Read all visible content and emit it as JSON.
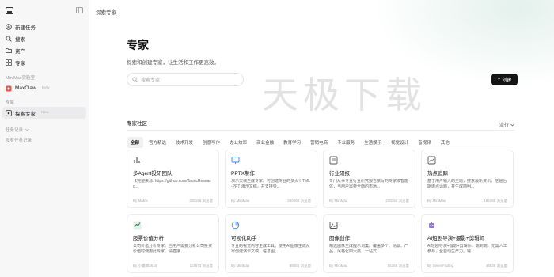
{
  "sidebar": {
    "items": [
      {
        "label": "新建任务",
        "icon": "plus-circle-icon"
      },
      {
        "label": "搜索",
        "icon": "search-icon"
      },
      {
        "label": "资产",
        "icon": "folder-icon"
      },
      {
        "label": "专家",
        "icon": "grid-icon"
      }
    ],
    "lab_section": "MiniMax实验室",
    "lab_item": {
      "label": "MaxClaw",
      "badge": "New"
    },
    "experts_section": "专家",
    "experts_item": {
      "label": "探索专家",
      "badge": "New"
    },
    "history_section": "任务记录",
    "history_empty": "没有任务记录"
  },
  "header": {
    "breadcrumb": "探索专家"
  },
  "hero": {
    "title": "专家",
    "subtitle": "探索和创建专家，让生活和工作更高效。",
    "search_placeholder": "搜索专家",
    "create_label": "创建",
    "watermark": "天极下载"
  },
  "community": {
    "title": "专家社区",
    "sort_label": "流行",
    "categories": [
      "全部",
      "官方精选",
      "技术开发",
      "创意写作",
      "办公效率",
      "商业金融",
      "教育学习",
      "营销电商",
      "专业服务",
      "生活娱乐",
      "视觉设计",
      "音视频",
      "其他"
    ],
    "cards": [
      {
        "title": "多Agent投研团队",
        "desc": "【完整来源: https://github.com/TauricResearc...",
        "author": "By Matrix",
        "views": "325196 浏览量",
        "icon": "chart-icon",
        "icon_color": "#555555"
      },
      {
        "title": "PPTX制作",
        "desc": "演示文稿生成专家。可创建专业的多页 HTML-PPT 演示文稿，并支持导...",
        "author": "By MiniMax",
        "views": "260098 浏览量",
        "icon": "slides-icon",
        "icon_color": "#3b82f6"
      },
      {
        "title": "行业研报",
        "desc": "专门从事专业行业研究报告撰写的专家级智能体，当用户需要全面的市场...",
        "author": "By MiniMax",
        "views": "238152 浏览量",
        "icon": "report-icon",
        "icon_color": "#555555"
      },
      {
        "title": "热点追踪",
        "desc": "基于用户输入的主题，搜索最新资讯，挖掘后期爆点话题，并生成简明...",
        "author": "By MiniMax",
        "views": "195388 浏览量",
        "icon": "trending-icon",
        "icon_color": "#555555"
      },
      {
        "title": "股票价值分析",
        "desc": "公司价值分析专家。当用户需要分析公司投资价值时使用此专家。请直接...",
        "author": "By 小螺蛳3616",
        "views": "114573 浏览量",
        "icon": "stock-icon",
        "icon_color": "#2e7d5b"
      },
      {
        "title": "可视化助手",
        "desc": "专业的视觉内容生成工具。使用AI图像生成从零创建演示文稿，信息图、...",
        "author": "By MiniMax",
        "views": "88056 浏览量",
        "icon": "pie-icon",
        "icon_color": "#3b82f6"
      },
      {
        "title": "图像创作",
        "desc": "精选图像生成提示词集。覆盖多个、场景、产品、风格化四大类，一站式...",
        "author": "By MiniMax",
        "views": "55369 浏览量",
        "icon": "image-icon",
        "icon_color": "#555555"
      },
      {
        "title": "AI短剧导演+摄影+剪辑师",
        "desc": "AI短剧导演+摄影+剪辑师，端到端，无需人工参与，全自动生产力。输...",
        "author": "By SevenFading",
        "views": "48838 浏览量",
        "icon": "robot-icon",
        "icon_color": "#7c5cd6"
      }
    ]
  }
}
